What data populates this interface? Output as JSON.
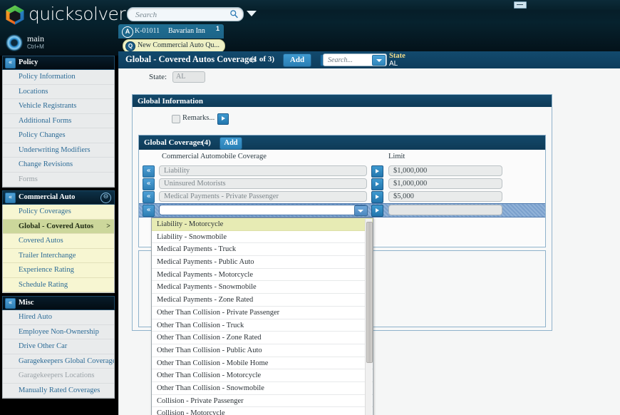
{
  "window": {
    "minimize_label": "–"
  },
  "topbar": {
    "brand": "quicksolver",
    "search_placeholder": "Search",
    "search_value": "",
    "search_icon": "search-icon",
    "caret_icon": "chevron-down-icon",
    "user": {
      "name": "main",
      "shortcut": "Ctrl+M"
    }
  },
  "account_tab": {
    "avatar_letter": "A",
    "number": "K-01011",
    "name": "Bavarian Inn",
    "badge": "1",
    "quote_avatar_letter": "Q",
    "quote_label": "New Commercial Auto Qu..."
  },
  "page_header": {
    "title": "Global - Covered Autos Coverages",
    "count": "(1 of 3)",
    "add_label": "Add",
    "play_icon": "play-icon",
    "search_placeholder": "Search...",
    "search_value": "",
    "search_dropdown_icon": "chevron-down-icon",
    "state_label": "State",
    "state_value": "AL"
  },
  "canvas": {
    "state_field_label": "State:",
    "state_field_value": "AL"
  },
  "global_information": {
    "title": "Global Information",
    "remarks_label": "Remarks...",
    "remarks_checked": false,
    "remarks_expand_icon": "play-icon"
  },
  "global_coverages": {
    "title": "Global Coverages",
    "count": "(4)",
    "add_label": "Add",
    "columns": [
      "Commercial Automobile Coverage",
      "Limit"
    ],
    "row_select_icon": "double-chevron-left-icon",
    "row_expand_icon": "play-icon",
    "rows": [
      {
        "coverage": "Liability",
        "limit": "$1,000,000",
        "active": false
      },
      {
        "coverage": "Uninsured Motorists",
        "limit": "$1,000,000",
        "active": false
      },
      {
        "coverage": "Medical Payments - Private Passenger",
        "limit": "$5,000",
        "active": false
      },
      {
        "coverage": "",
        "limit": "",
        "active": true
      }
    ]
  },
  "dropdown": {
    "selected": "Liability - Motorcycle",
    "items": [
      "Liability - Motorcycle",
      "Liability - Snowmobile",
      "Medical Payments - Truck",
      "Medical Payments - Public Auto",
      "Medical Payments - Motorcycle",
      "Medical Payments - Snowmobile",
      "Medical Payments - Zone Rated",
      "Other Than Collision - Private Passenger",
      "Other Than Collision - Truck",
      "Other Than Collision - Zone Rated",
      "Other Than Collision - Public Auto",
      "Other Than Collision - Mobile Home",
      "Other Than Collision - Motorcycle",
      "Other Than Collision - Snowmobile",
      "Collision - Private Passenger",
      "Collision - Motorcycle"
    ]
  },
  "sidebar": {
    "groups": [
      {
        "title": "Policy",
        "icon": "double-chevron-left-icon",
        "right_icon": "",
        "style": "dark",
        "items": [
          {
            "label": "Policy Information",
            "state": "normal"
          },
          {
            "label": "Locations",
            "state": "normal"
          },
          {
            "label": "Vehicle Registrants",
            "state": "normal"
          },
          {
            "label": "Additional Forms",
            "state": "normal"
          },
          {
            "label": "Policy Changes",
            "state": "normal"
          },
          {
            "label": "Underwriting Modifiers",
            "state": "normal"
          },
          {
            "label": "Change Revisions",
            "state": "normal"
          },
          {
            "label": "Forms",
            "state": "disabled"
          }
        ]
      },
      {
        "title": "Commercial Auto",
        "icon": "double-chevron-left-icon",
        "right_icon": "neutral-face-icon",
        "style": "blue",
        "list_style": "yellow",
        "items": [
          {
            "label": "Policy Coverages",
            "state": "normal"
          },
          {
            "label": "Global - Covered Autos",
            "state": "active",
            "chevron": ">"
          },
          {
            "label": "Covered Autos",
            "state": "normal"
          },
          {
            "label": "Trailer Interchange",
            "state": "normal"
          },
          {
            "label": "Experience Rating",
            "state": "normal"
          },
          {
            "label": "Schedule Rating",
            "state": "normal"
          }
        ]
      },
      {
        "title": "Misc",
        "icon": "double-chevron-left-icon",
        "right_icon": "",
        "style": "dark",
        "items": [
          {
            "label": "Hired Auto",
            "state": "normal"
          },
          {
            "label": "Employee Non-Ownership",
            "state": "normal"
          },
          {
            "label": "Drive Other Car",
            "state": "normal"
          },
          {
            "label": "Garagekeepers Global Coverages",
            "state": "normal"
          },
          {
            "label": "Garagekeepers Locations",
            "state": "disabled"
          },
          {
            "label": "Manually Rated Coverages",
            "state": "normal"
          }
        ]
      }
    ]
  },
  "colors": {
    "header_blue": "#0e3a57",
    "accent_blue": "#2f7fb4",
    "active_green": "#ccd79b",
    "yellow_list": "#f7f6d2",
    "selected_dropdown": "#e7ebb4"
  }
}
